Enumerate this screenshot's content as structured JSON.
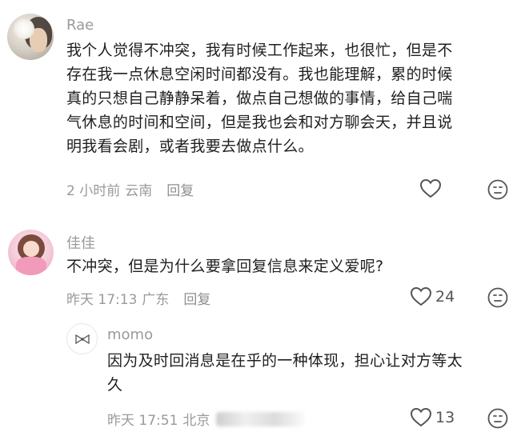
{
  "comments": [
    {
      "name": "Rae",
      "lines": [
        "我个人觉得不冲突，我有时候工作起来，也很忙，但是不",
        "存在我一点休息空闲时间都没有。我也能理解，累的时候",
        "真的只想自己静静呆着，做点自己想做的事情，给自己喘",
        "气休息的时间和空间，但是我也会和对方聊会天，并且说",
        "明我看会剧，或者我要去做点什么。"
      ],
      "time": "2 小时前",
      "location": "云南",
      "reply_label": "回复",
      "likes": ""
    },
    {
      "name": "佳佳",
      "lines": [
        "不冲突，但是为什么要拿回复信息来定义爱呢?"
      ],
      "time": "昨天 17:13",
      "location": "广东",
      "reply_label": "回复",
      "likes": "24"
    },
    {
      "name": "momo",
      "lines": [
        "因为及时回消息是在乎的一种体现，担心让对方等太",
        "久"
      ],
      "time": "昨天 17:51",
      "location": "北京",
      "likes": "13"
    }
  ],
  "icons": {
    "like": "heart-outline-icon",
    "dislike": "meh-face-icon"
  },
  "colors": {
    "text": "#1f1f1f",
    "meta": "#9a9a9a",
    "icon": "#555555"
  }
}
